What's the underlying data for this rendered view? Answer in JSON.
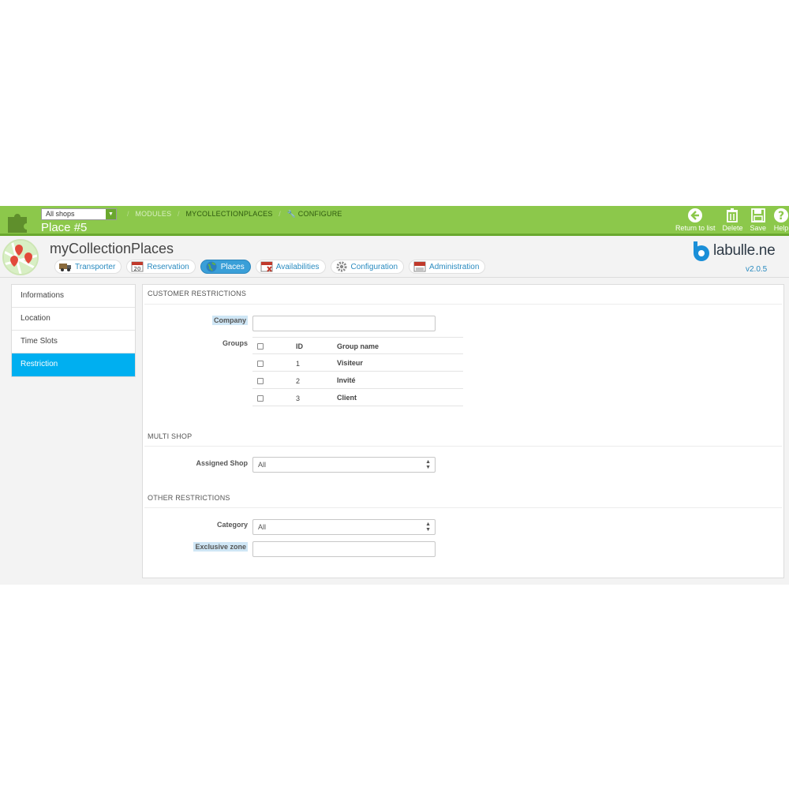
{
  "header": {
    "shop_select": "All shops",
    "breadcrumb": [
      "MODULES",
      "MYCOLLECTIONPLACES",
      "CONFIGURE"
    ],
    "page_title": "Place #5",
    "toolbar": [
      {
        "label": "Return to list",
        "icon": "back-arrow-icon"
      },
      {
        "label": "Delete",
        "icon": "trash-icon"
      },
      {
        "label": "Save",
        "icon": "floppy-icon"
      },
      {
        "label": "Help",
        "icon": "help-icon"
      }
    ]
  },
  "module": {
    "title": "myCollectionPlaces",
    "brand": "labulle.ne",
    "version": "v2.0.5",
    "tabs": [
      {
        "label": "Transporter",
        "icon": "truck-icon"
      },
      {
        "label": "Reservation",
        "icon": "calendar-icon"
      },
      {
        "label": "Places",
        "icon": "globe-icon",
        "active": true
      },
      {
        "label": "Availabilities",
        "icon": "calendar-x-icon"
      },
      {
        "label": "Configuration",
        "icon": "gear-icon"
      },
      {
        "label": "Administration",
        "icon": "calendar-red-icon"
      }
    ]
  },
  "sidebar": {
    "items": [
      {
        "label": "Informations"
      },
      {
        "label": "Location"
      },
      {
        "label": "Time Slots"
      },
      {
        "label": "Restriction",
        "active": true
      }
    ]
  },
  "form": {
    "customer_restrictions": {
      "title": "CUSTOMER RESTRICTIONS",
      "company_label": "Company",
      "company_value": "",
      "groups_label": "Groups",
      "groups_table": {
        "headers": [
          "ID",
          "Group name"
        ],
        "rows": [
          {
            "id": "1",
            "name": "Visiteur"
          },
          {
            "id": "2",
            "name": "Invité"
          },
          {
            "id": "3",
            "name": "Client"
          }
        ]
      }
    },
    "multi_shop": {
      "title": "MULTI SHOP",
      "assigned_shop_label": "Assigned Shop",
      "assigned_shop_value": "All"
    },
    "other_restrictions": {
      "title": "OTHER RESTRICTIONS",
      "category_label": "Category",
      "category_value": "All",
      "exclusive_zone_label": "Exclusive zone",
      "exclusive_zone_value": ""
    }
  },
  "colors": {
    "header_green": "#8cc84b",
    "active_blue": "#00aff0",
    "link_blue": "#2a8bc0"
  }
}
